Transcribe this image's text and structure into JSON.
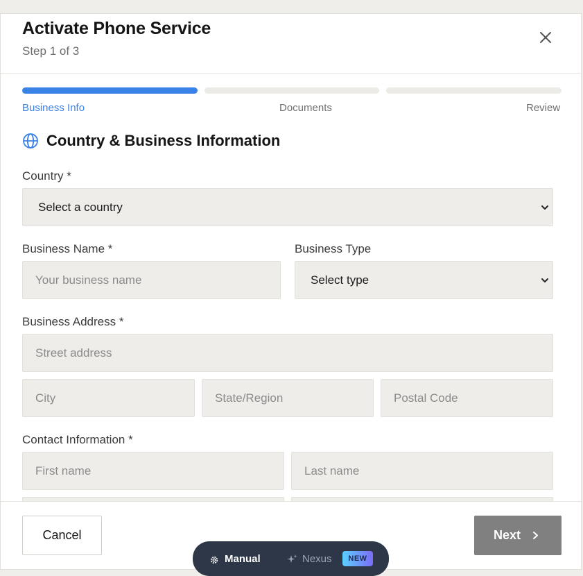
{
  "modal": {
    "title": "Activate Phone Service",
    "step_text": "Step 1 of 3"
  },
  "steps": [
    {
      "label": "Business Info",
      "active": true
    },
    {
      "label": "Documents",
      "active": false
    },
    {
      "label": "Review",
      "active": false
    }
  ],
  "section": {
    "title": "Country & Business Information",
    "icon": "globe-icon"
  },
  "form": {
    "country_label": "Country *",
    "country_value": "Select a country",
    "business_name_label": "Business Name *",
    "business_name_placeholder": "Your business name",
    "business_type_label": "Business Type",
    "business_type_value": "Select type",
    "address_label": "Business Address *",
    "street_placeholder": "Street address",
    "city_placeholder": "City",
    "state_placeholder": "State/Region",
    "postal_placeholder": "Postal Code",
    "contact_label": "Contact Information *",
    "first_name_placeholder": "First name",
    "last_name_placeholder": "Last name"
  },
  "footer": {
    "cancel_label": "Cancel",
    "next_label": "Next"
  },
  "mode_switch": {
    "manual_label": "Manual",
    "nexus_label": "Nexus",
    "badge_label": "NEW"
  },
  "colors": {
    "accent": "#3b82e8",
    "next_disabled": "#808080",
    "field_bg": "#efede9",
    "mode_bar_bg": "#2d3748"
  }
}
